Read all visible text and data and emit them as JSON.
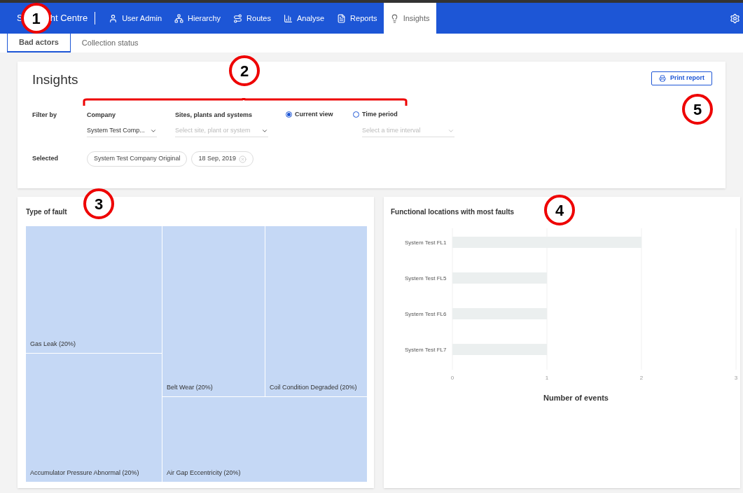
{
  "nav": {
    "brand_parts": [
      "S",
      "ht Centre"
    ],
    "items": [
      {
        "label": "User Admin",
        "selected": false
      },
      {
        "label": "Hierarchy",
        "selected": false
      },
      {
        "label": "Routes",
        "selected": false
      },
      {
        "label": "Analyse",
        "selected": false
      },
      {
        "label": "Reports",
        "selected": false
      },
      {
        "label": "Insights",
        "selected": true
      }
    ]
  },
  "subtabs": [
    {
      "label": "Bad actors",
      "selected": true
    },
    {
      "label": "Collection status",
      "selected": false
    }
  ],
  "insights": {
    "title": "Insights",
    "print_button": "Print report",
    "filter_label": "Filter by",
    "company": {
      "label": "Company",
      "value": "System Test Comp..."
    },
    "sites": {
      "label": "Sites, plants and systems",
      "placeholder": "Select site, plant or system"
    },
    "radios": [
      {
        "label": "Current view",
        "selected": true
      },
      {
        "label": "Time period",
        "selected": false
      }
    ],
    "time": {
      "placeholder": "Select a time interval"
    },
    "selected_label": "Selected",
    "chips": [
      {
        "label": "System Test Company Original",
        "removable": false
      },
      {
        "label": "18 Sep, 2019",
        "removable": true
      }
    ]
  },
  "fault_types": {
    "title": "Type of fault",
    "tiles": [
      {
        "label": "Gas Leak (20%)"
      },
      {
        "label": "Accumulator Pressure Abnormal (20%)"
      },
      {
        "label": "Belt Wear (20%)"
      },
      {
        "label": "Coil Condition Degraded (20%)"
      },
      {
        "label": "Air Gap Eccentricity (20%)"
      }
    ]
  },
  "locations": {
    "chart_data": {
      "type": "bar",
      "orientation": "horizontal",
      "title": "Functional locations with most faults",
      "xlabel": "Number of events",
      "categories": [
        "System Test FL1",
        "System Test FL5",
        "System Test FL6",
        "System Test FL7"
      ],
      "values": [
        2,
        1,
        1,
        1
      ],
      "xlim": [
        0,
        3
      ],
      "xticks": [
        0,
        1,
        2,
        3
      ]
    }
  },
  "callouts": [
    {
      "label": "1"
    },
    {
      "label": "2"
    },
    {
      "label": "3"
    },
    {
      "label": "4"
    },
    {
      "label": "5"
    }
  ]
}
